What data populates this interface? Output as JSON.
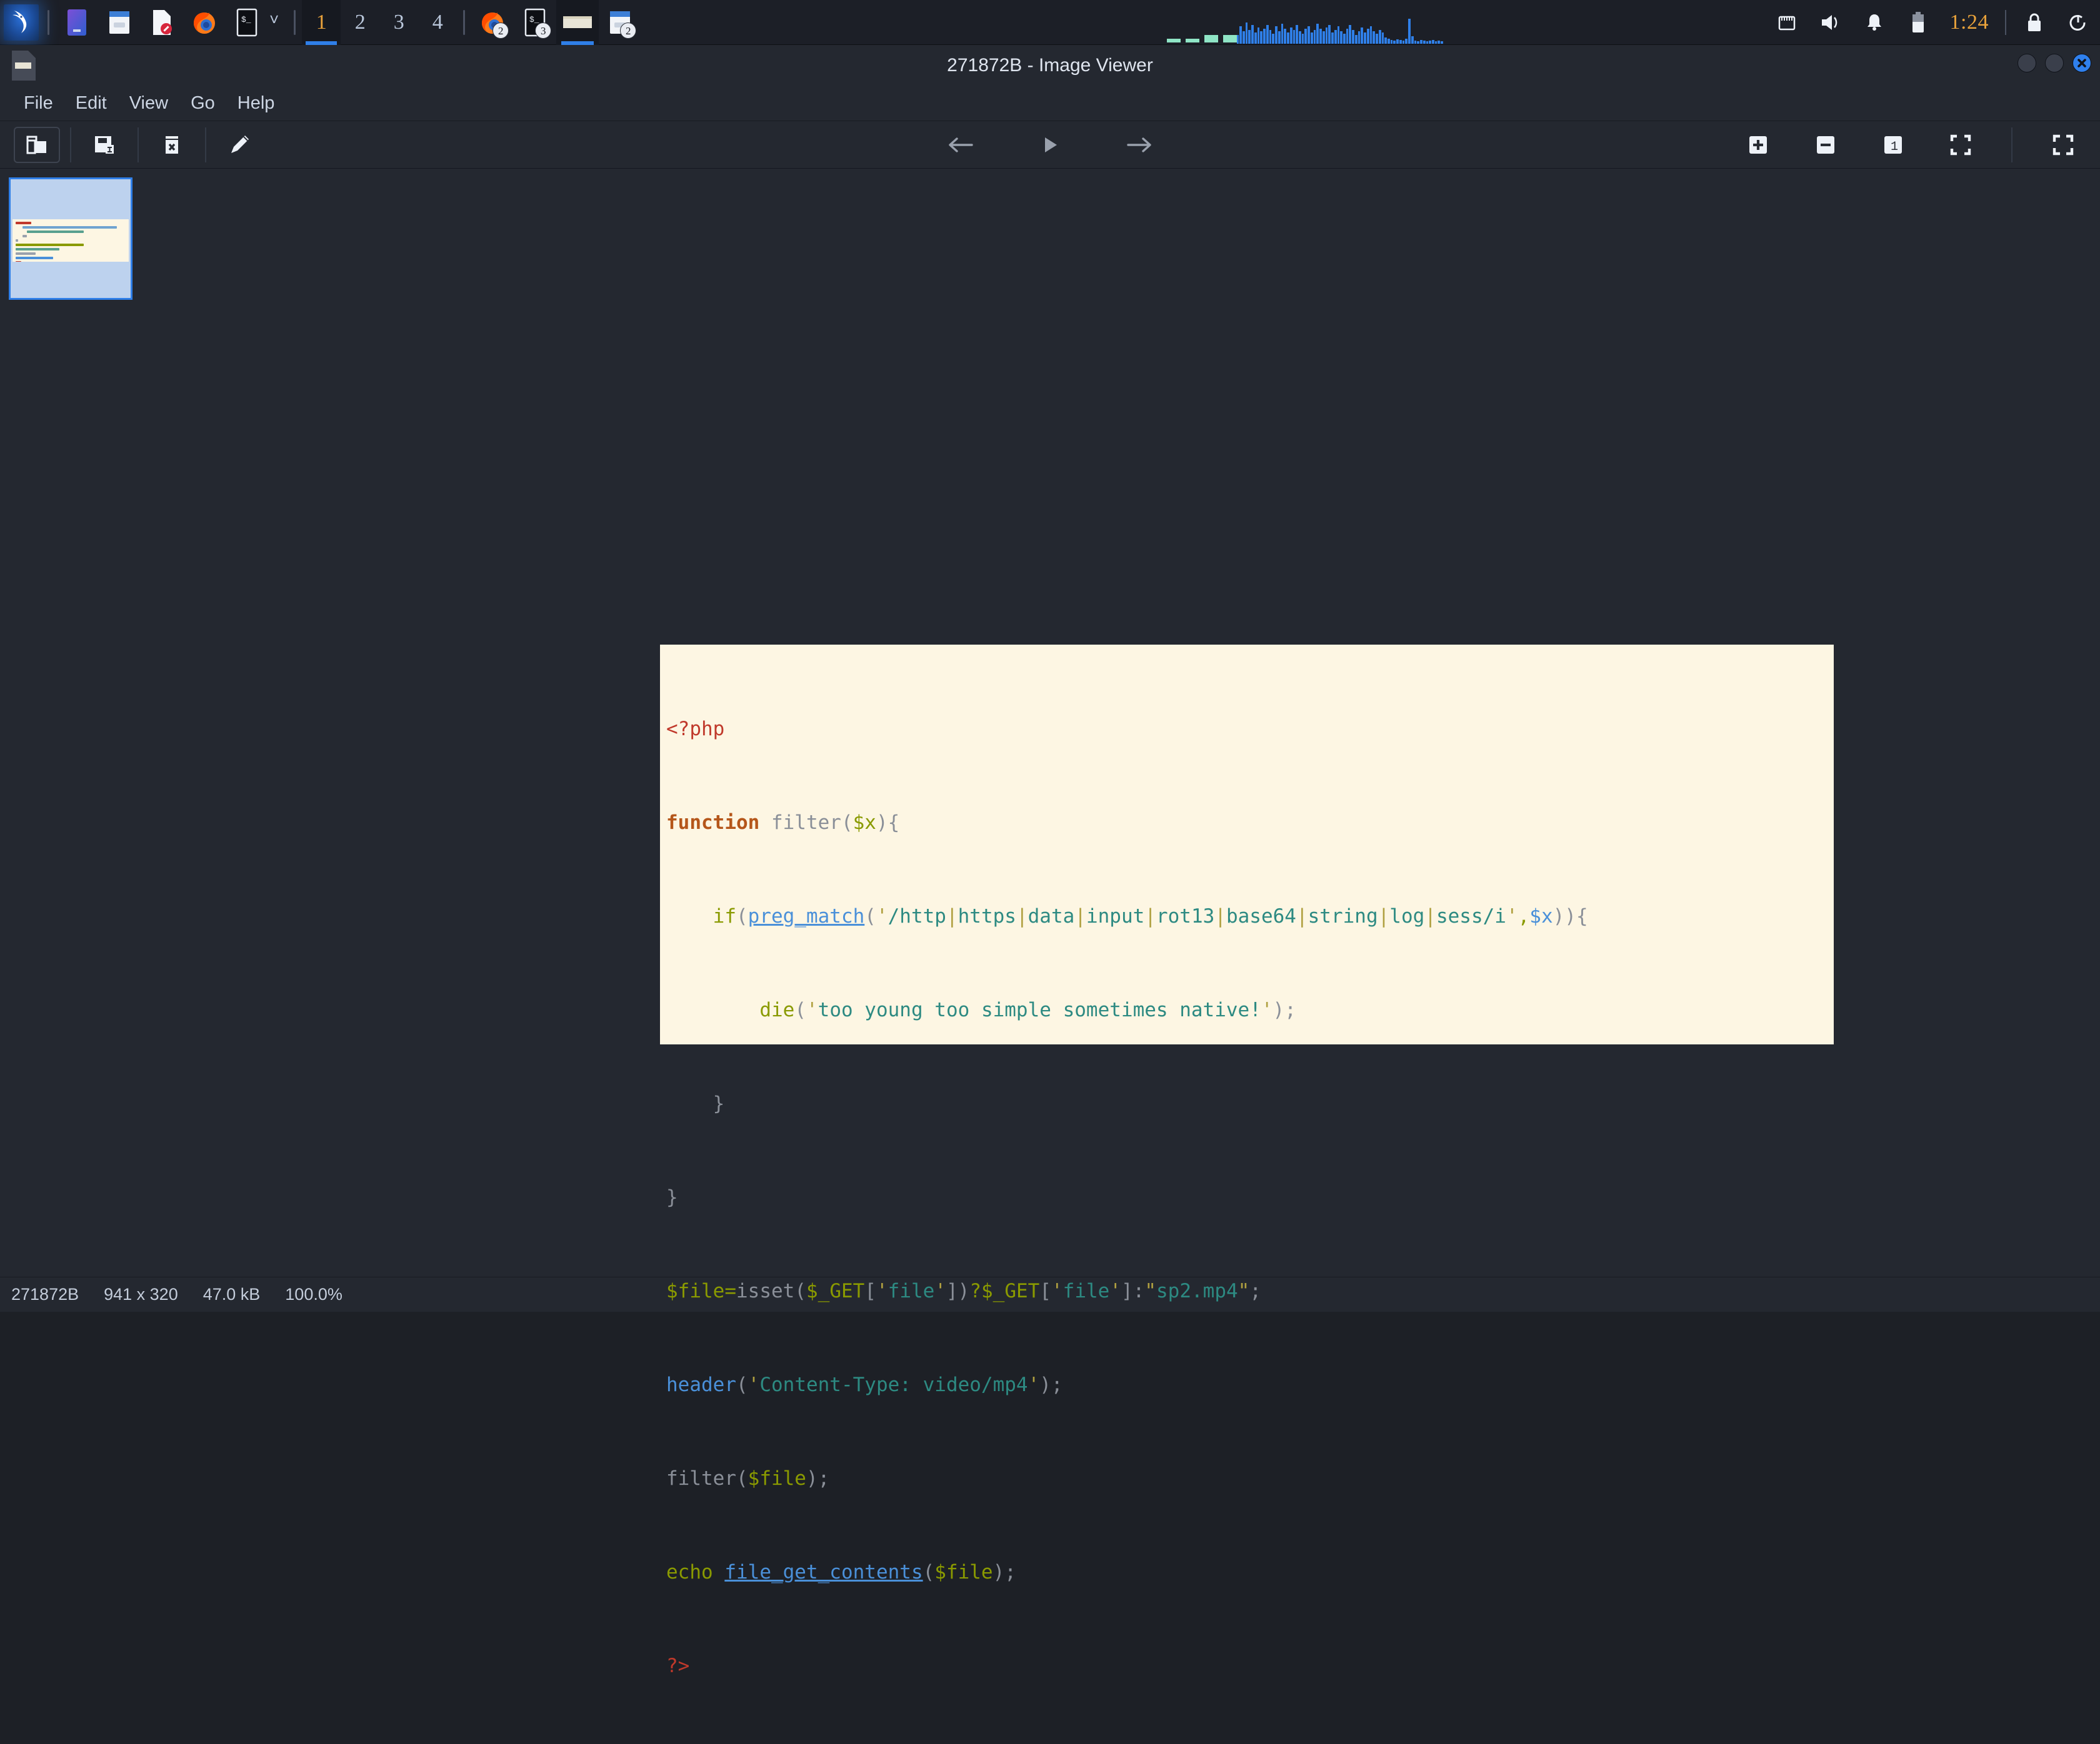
{
  "taskbar": {
    "launchers": [
      {
        "name": "kali-menu-icon",
        "label": "Kali Menu"
      },
      {
        "name": "files-manager-icon",
        "label": "File Manager"
      },
      {
        "name": "folder-icon",
        "label": "Folder"
      },
      {
        "name": "text-editor-icon",
        "label": "Text Editor"
      },
      {
        "name": "firefox-icon",
        "label": "Firefox"
      },
      {
        "name": "terminal-icon",
        "label": "Terminal"
      }
    ],
    "dropdown_caret": "˅",
    "workspaces": [
      "1",
      "2",
      "3",
      "4"
    ],
    "active_workspace": "1",
    "windows": [
      {
        "name": "firefox-window-button",
        "badge": "2"
      },
      {
        "name": "terminal-window-button",
        "badge": "3"
      },
      {
        "name": "image-viewer-window-button",
        "badge": ""
      },
      {
        "name": "file-manager-window-button",
        "badge": "2"
      }
    ],
    "tray": [
      {
        "name": "network-icon"
      },
      {
        "name": "volume-icon"
      },
      {
        "name": "notification-bell-icon"
      },
      {
        "name": "battery-icon"
      }
    ],
    "clock": "1:24",
    "lock_icon": "lock-icon",
    "logout_icon": "logout-icon",
    "accent_blue": "#2f7fe8",
    "accent_orange": "#e9a23b",
    "bar_bg": "#1c1f27"
  },
  "window": {
    "title": "271872B - Image Viewer",
    "controls": [
      "minimize",
      "maximize",
      "close"
    ],
    "menus": [
      "File",
      "Edit",
      "View",
      "Go",
      "Help"
    ],
    "toolbar": {
      "left": [
        {
          "name": "open-image-button",
          "icon": "open-folder-icon"
        },
        {
          "name": "save-image-button",
          "icon": "save-floppy-icon"
        },
        {
          "name": "delete-image-button",
          "icon": "trash-icon"
        },
        {
          "name": "edit-image-button",
          "icon": "pencil-icon"
        }
      ],
      "center": [
        {
          "name": "previous-image-button",
          "icon": "arrow-left-icon"
        },
        {
          "name": "slideshow-play-button",
          "icon": "play-icon"
        },
        {
          "name": "next-image-button",
          "icon": "arrow-right-icon"
        }
      ],
      "right": [
        {
          "name": "zoom-in-button",
          "icon": "plus-square-icon"
        },
        {
          "name": "zoom-out-button",
          "icon": "minus-square-icon"
        },
        {
          "name": "zoom-actual-size-button",
          "icon": "one-square-icon"
        },
        {
          "name": "zoom-fit-button",
          "icon": "fit-frame-icon"
        },
        {
          "name": "fullscreen-button",
          "icon": "fullscreen-icon"
        }
      ]
    }
  },
  "statusbar": {
    "filename": "271872B",
    "dimensions": "941 x 320",
    "filesize": "47.0 kB",
    "zoom": "100.0%"
  },
  "image": {
    "background": "#fdf6e3",
    "code_lines": [
      "<?php",
      "function filter($x){",
      "    if(preg_match('/http|https|data|input|rot13|base64|string|log|sess/i',$x)){",
      "        die('too young too simple sometimes native!');",
      "    }",
      "}",
      "$file=isset($_GET['file'])?$_GET['file']:\"sp2.mp4\";",
      "header('Content-Type: video/mp4');",
      "filter($file);",
      "echo file_get_contents($file);",
      "?>"
    ]
  }
}
